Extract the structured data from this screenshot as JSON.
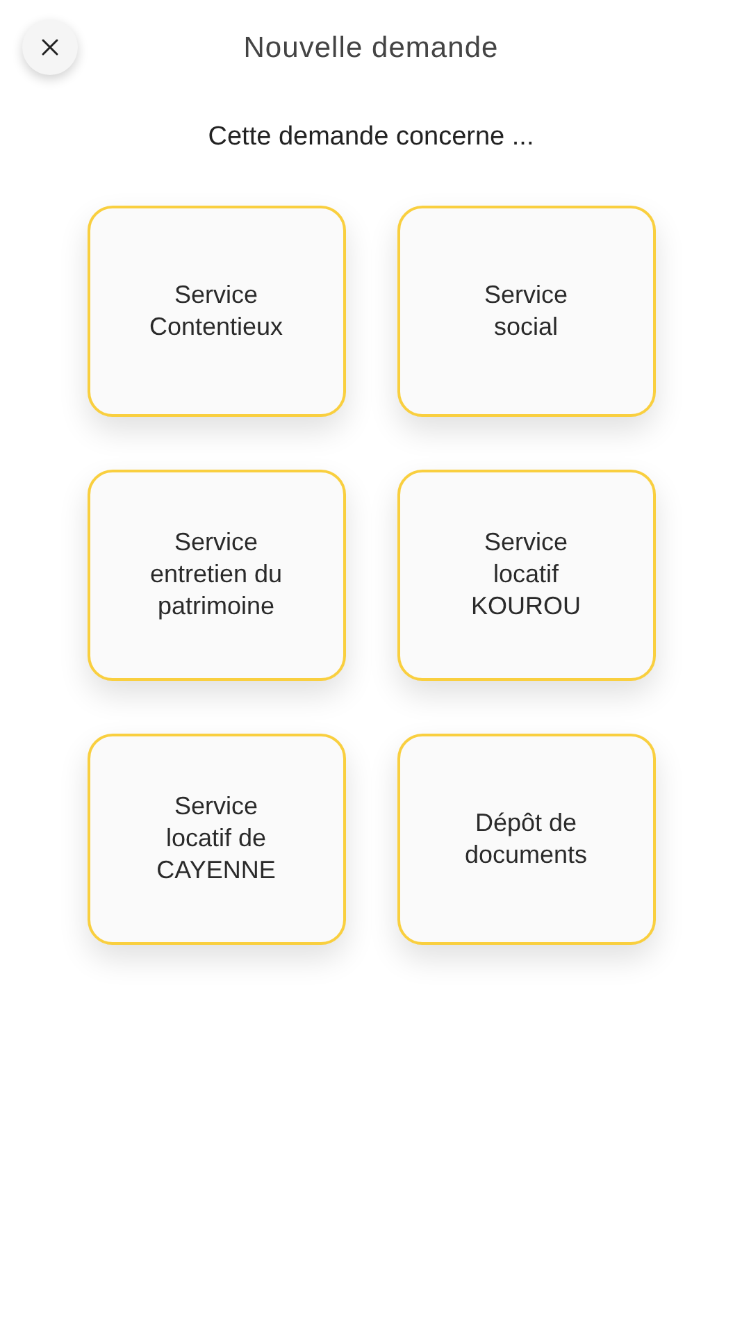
{
  "header": {
    "title": "Nouvelle demande"
  },
  "prompt": "Cette demande concerne ...",
  "options": [
    {
      "label": "Service\nContentieux"
    },
    {
      "label": "Service\nsocial"
    },
    {
      "label": "Service\nentretien du\npatrimoine"
    },
    {
      "label": "Service\nlocatif\nKOUROU"
    },
    {
      "label": "Service\nlocatif de\nCAYENNE"
    },
    {
      "label": "Dépôt de\ndocuments"
    }
  ]
}
